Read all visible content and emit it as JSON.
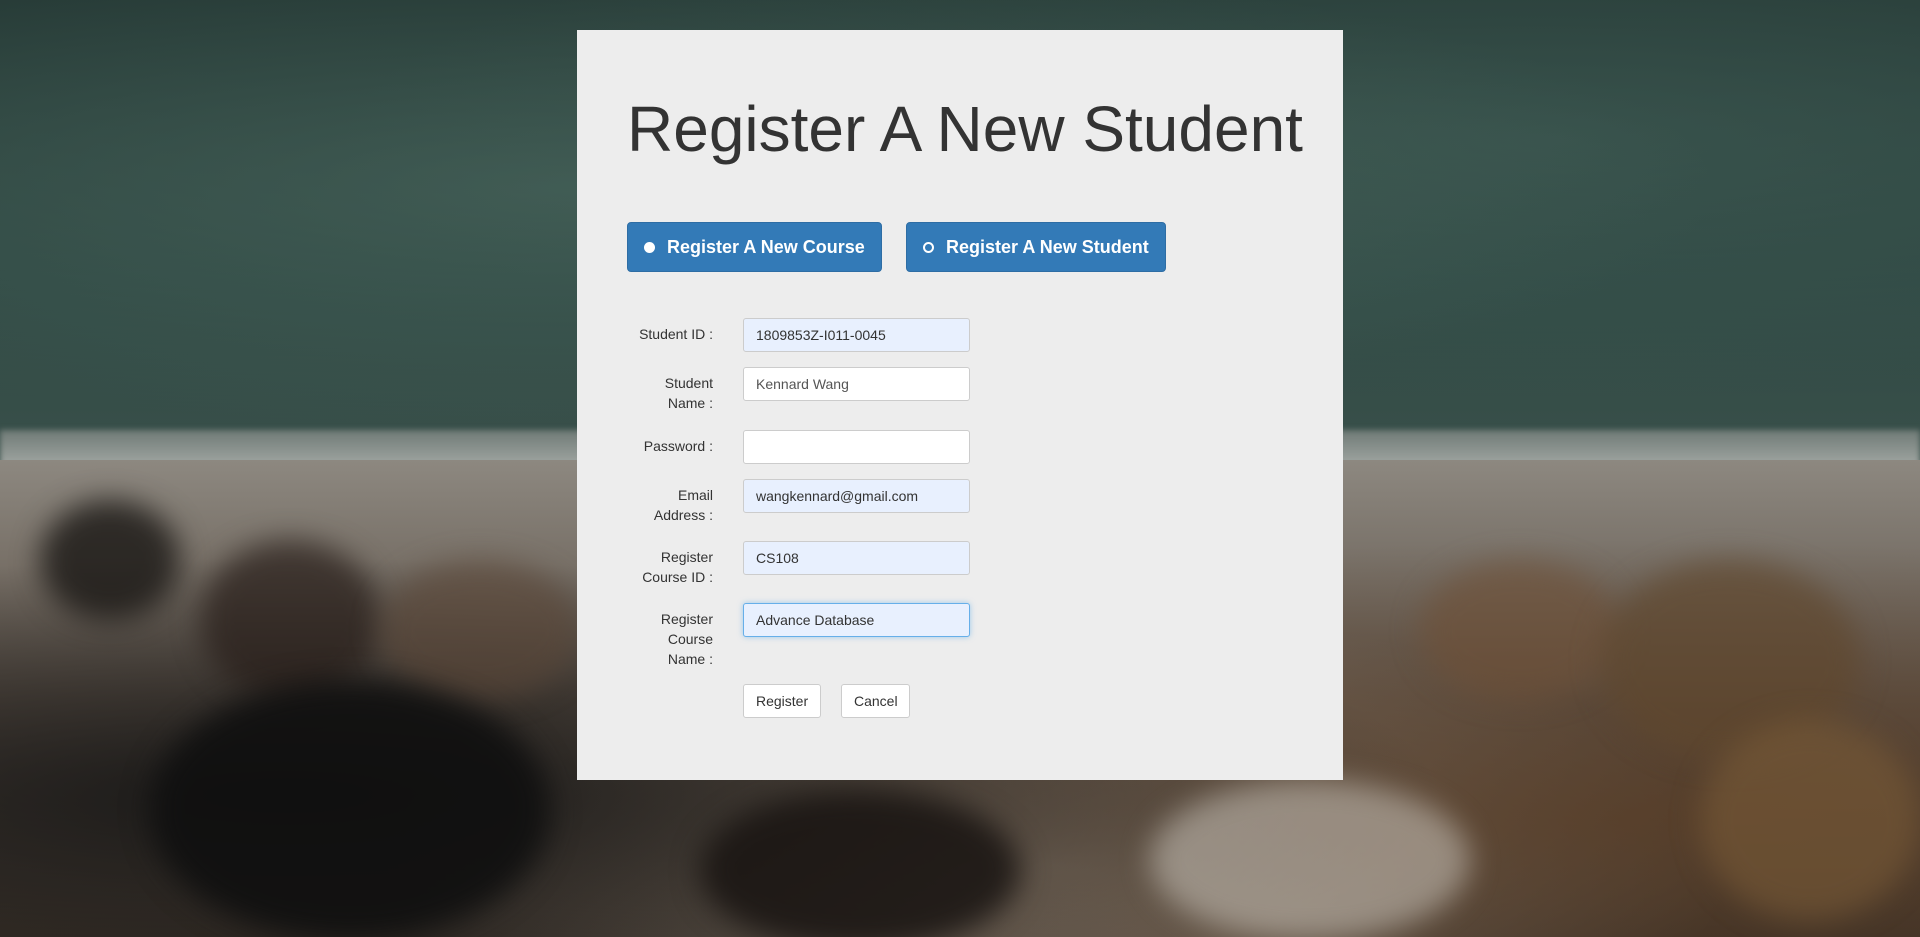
{
  "page": {
    "title": "Register A New Student"
  },
  "mode_toggle": {
    "options": [
      {
        "label": "Register A New Course",
        "selected": false
      },
      {
        "label": "Register A New Student",
        "selected": true
      }
    ]
  },
  "form": {
    "student_id": {
      "label": "Student ID :",
      "value": "1809853Z-I011-0045"
    },
    "student_name": {
      "label": "Student Name :",
      "value": "",
      "placeholder": "Kennard Wang"
    },
    "password": {
      "label": "Password :",
      "value": ""
    },
    "email": {
      "label": "Email Address :",
      "value": "wangkennard@gmail.com"
    },
    "course_id": {
      "label": "Register Course ID :",
      "value": "CS108"
    },
    "course_name": {
      "label": "Register Course Name :",
      "value": "Advance Database"
    }
  },
  "actions": {
    "register_label": "Register",
    "cancel_label": "Cancel"
  },
  "colors": {
    "primary": "#337ab7",
    "panel": "#ededed",
    "autofill": "#e8f0fe",
    "focus": "#66afe9"
  }
}
